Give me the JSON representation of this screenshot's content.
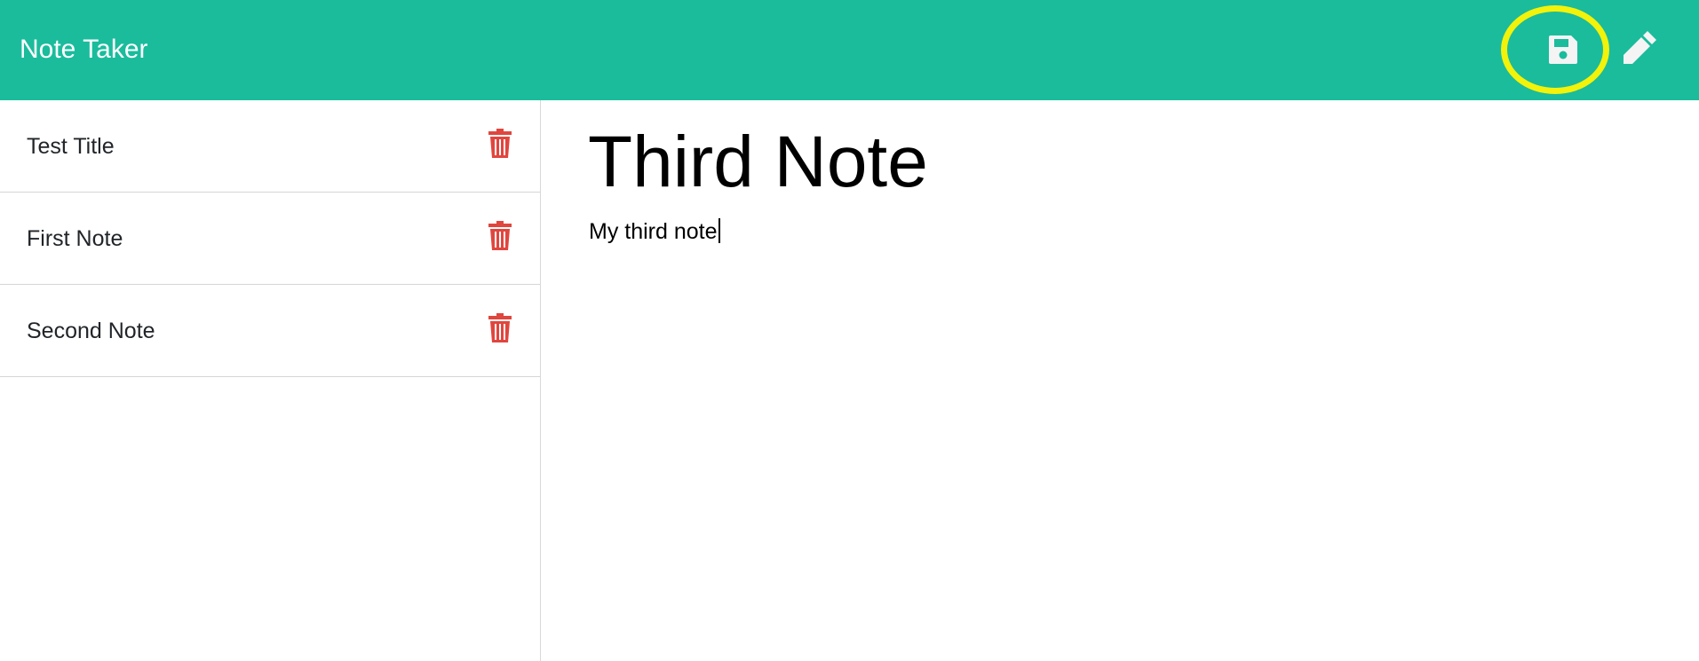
{
  "navbar": {
    "brand": "Note Taker",
    "save_icon": "floppy-disk-icon",
    "new_icon": "pencil-icon",
    "highlight_color": "#f2f20a",
    "background_color": "#1abc9c"
  },
  "notes": [
    {
      "title": "Test Title",
      "delete_icon": "trash-icon"
    },
    {
      "title": "First Note",
      "delete_icon": "trash-icon"
    },
    {
      "title": "Second Note",
      "delete_icon": "trash-icon"
    }
  ],
  "editor": {
    "title": "Third Note",
    "body": "My third note"
  },
  "colors": {
    "delete": "#e0463e"
  }
}
